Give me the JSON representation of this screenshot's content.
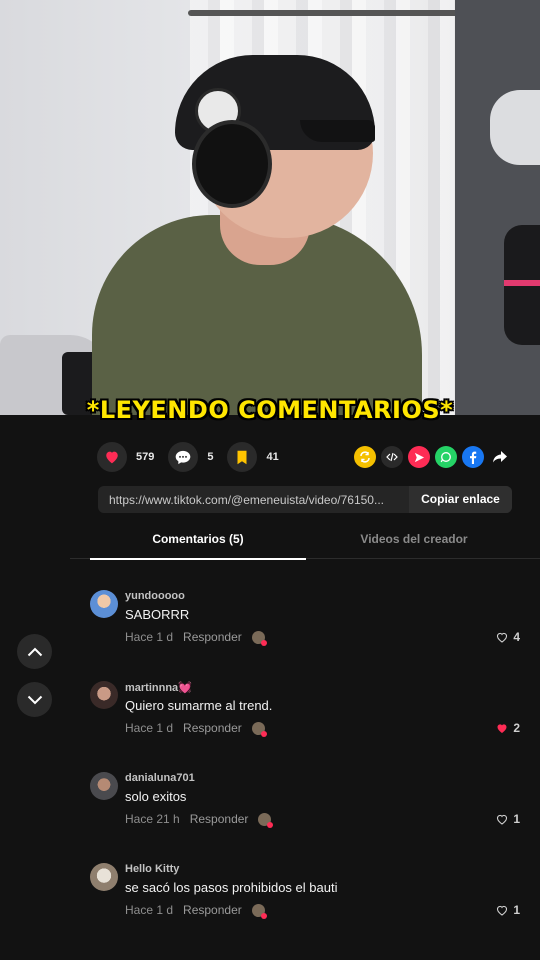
{
  "video": {
    "overlay_title": "*LEYENDO COMENTARIOS*"
  },
  "actions": {
    "likes": "579",
    "comments": "5",
    "saves": "41",
    "like_icon": "heart-icon",
    "comment_icon": "comment-bubble-icon",
    "save_icon": "bookmark-icon"
  },
  "share": {
    "icons": [
      "repost-icon",
      "embed-icon",
      "send-icon",
      "whatsapp-icon",
      "facebook-icon",
      "share-arrow-icon"
    ],
    "colors": {
      "repost": "#f5c000",
      "send": "#fe2c55",
      "whatsapp": "#25d366",
      "facebook": "#1877f2"
    }
  },
  "link": {
    "url": "https://www.tiktok.com/@emeneuista/video/76150...",
    "copy_label": "Copiar enlace"
  },
  "tabs": {
    "comments": "Comentarios (5)",
    "creator_videos": "Videos del creador"
  },
  "comments": [
    {
      "user": "yundooooo",
      "text": "SABORRR",
      "time": "Hace 1 d",
      "reply": "Responder",
      "likes": "4",
      "liked": false
    },
    {
      "user": "martinnna💓",
      "text": "Quiero sumarme al trend.",
      "time": "Hace 1 d",
      "reply": "Responder",
      "likes": "2",
      "liked": true
    },
    {
      "user": "danialuna701",
      "text": "solo exitos",
      "time": "Hace 21 h",
      "reply": "Responder",
      "likes": "1",
      "liked": false
    },
    {
      "user": "Hello Kitty",
      "text": "se sacó los pasos prohibidos el bauti",
      "time": "Hace 1 d",
      "reply": "Responder",
      "likes": "1",
      "liked": false
    }
  ],
  "colors": {
    "accent": "#fe2c55",
    "overlay_text": "#ffe600",
    "background": "#121212"
  }
}
